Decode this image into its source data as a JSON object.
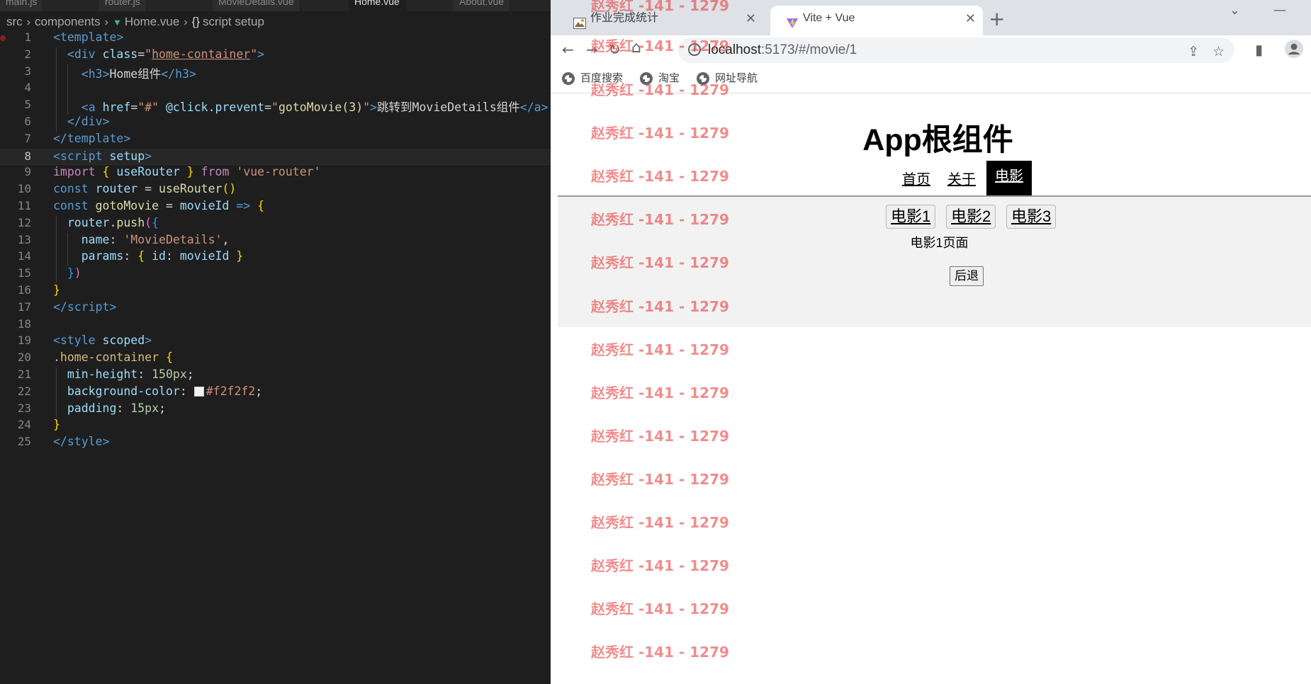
{
  "editor": {
    "tabs": [
      "main.js",
      "router.js",
      "MovieDetails.vue",
      "Home.vue",
      "About.vue"
    ],
    "breadcrumb": {
      "src": "src",
      "components": "components",
      "file": "Home.vue",
      "symbol": "script setup"
    },
    "line_numbers": [
      "1",
      "2",
      "3",
      "4",
      "5",
      "6",
      "7",
      "8",
      "9",
      "10",
      "11",
      "12",
      "13",
      "14",
      "15",
      "16",
      "17",
      "18",
      "19",
      "20",
      "21",
      "22",
      "23",
      "24",
      "25"
    ],
    "code": {
      "l1_tag": "template",
      "l2_div": "div",
      "l2_attr": "class",
      "l2_val": "home-container",
      "l3_h3": "h3",
      "l3_text": "Home组件",
      "l5_a": "a",
      "l5_href": "href",
      "l5_href_val": "\"#\"",
      "l5_click": "@click.prevent",
      "l5_click_val": "gotoMovie(3)",
      "l5_text": "跳转到MovieDetails组件",
      "l8_script": "script",
      "l8_setup": "setup",
      "l9_import": "import",
      "l9_name": "useRouter",
      "l9_from": "from",
      "l9_module": "'vue-router'",
      "l10_const": "const",
      "l10_var": "router",
      "l10_fn": "useRouter",
      "l11_const": "const",
      "l11_fn": "gotoMovie",
      "l11_param": "movieId",
      "l12_obj": "router",
      "l12_method": "push",
      "l13_key": "name",
      "l13_val": "'MovieDetails'",
      "l14_key": "params",
      "l14_inner_key": "id",
      "l14_inner_val": "movieId",
      "l19_style": "style",
      "l19_scoped": "scoped",
      "l20_selector": ".home-container",
      "l21_prop": "min-height",
      "l21_val": "150px",
      "l22_prop": "background-color",
      "l22_val": "#f2f2f2",
      "l23_prop": "padding",
      "l23_val": "15px"
    }
  },
  "browser": {
    "tabs": [
      {
        "title": "作业完成统计"
      },
      {
        "title": "Vite + Vue"
      }
    ],
    "url_host": "localhost",
    "url_path": ":5173/#/movie/1",
    "bookmarks": [
      "百度搜索",
      "淘宝",
      "网址导航"
    ],
    "page": {
      "app_title": "App根组件",
      "nav": [
        "首页",
        "关于",
        "电影"
      ],
      "active_nav": "电影",
      "movie_links": [
        "电影1",
        "电影2",
        "电影3"
      ],
      "movie_text": "电影1页面",
      "back_button": "后退"
    }
  },
  "watermark": {
    "text": "赵秀红 -141 - 1279",
    "color": "#e84646"
  },
  "colors": {
    "editor_bg": "#1e1e1e",
    "movie_box_bg": "#f2f2f2",
    "vue_green": "#41b883"
  }
}
